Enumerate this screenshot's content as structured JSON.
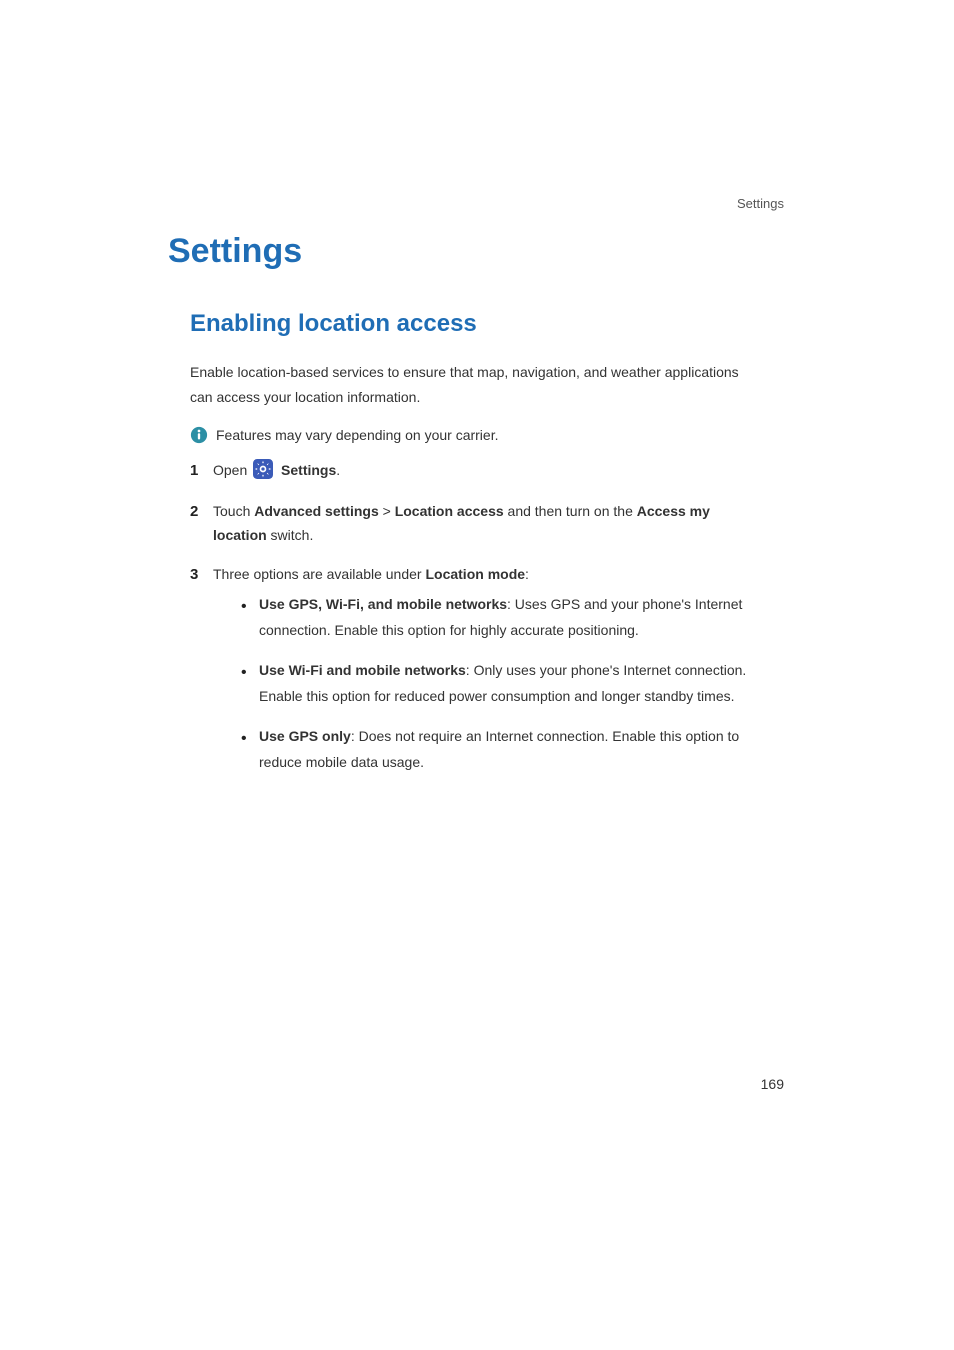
{
  "header": {
    "label": "Settings"
  },
  "chapter": {
    "title": "Settings"
  },
  "section": {
    "title": "Enabling location access"
  },
  "intro": "Enable location-based services to ensure that map, navigation, and weather applications can access your location information.",
  "note": "Features may vary depending on your carrier.",
  "steps": {
    "one": {
      "num": "1",
      "open": "Open",
      "app": "Settings",
      "period": "."
    },
    "two": {
      "num": "2",
      "touch": "Touch ",
      "advanced": "Advanced settings",
      "sep": " > ",
      "location_access": "Location access",
      "mid": " and then turn on the ",
      "access_my_location": "Access my location",
      "tail": " switch."
    },
    "three": {
      "num": "3",
      "lead": "Three options are available under ",
      "mode": "Location mode",
      "colon": ":"
    }
  },
  "bullets": {
    "b1": {
      "title": "Use GPS, Wi-Fi, and mobile networks",
      "desc": ": Uses GPS and your phone's Internet connection. Enable this option for highly accurate positioning."
    },
    "b2": {
      "title": "Use Wi-Fi and mobile networks",
      "desc": ": Only uses your phone's Internet connection. Enable this option for reduced power consumption and longer standby times."
    },
    "b3": {
      "title": "Use GPS only",
      "desc": ": Does not require an Internet connection. Enable this option to reduce mobile data usage."
    }
  },
  "page_number": "169"
}
